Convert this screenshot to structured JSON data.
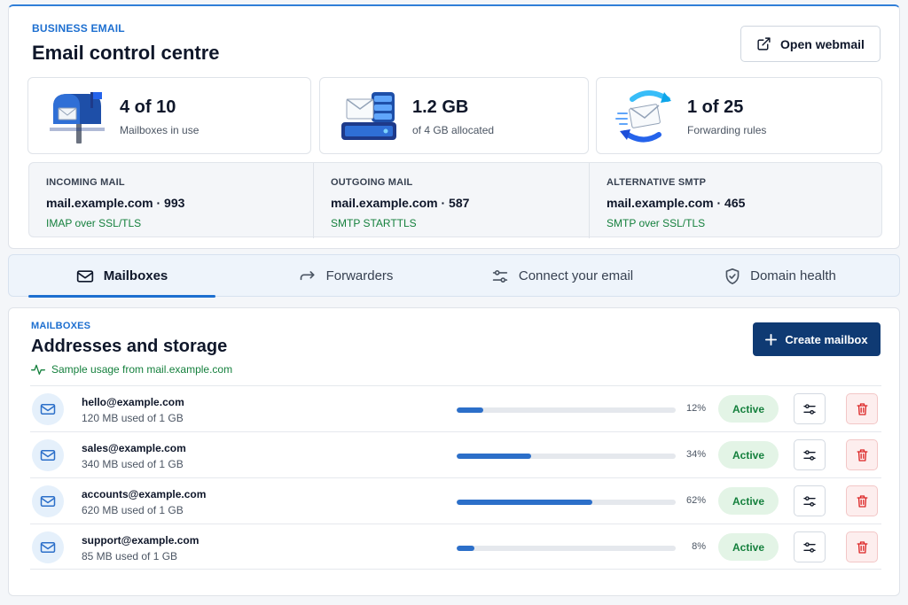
{
  "header": {
    "eyebrow": "BUSINESS EMAIL",
    "title": "Email control centre",
    "open_webmail_label": "Open webmail"
  },
  "stats": [
    {
      "value": "4 of 10",
      "label": "Mailboxes in use",
      "icon": "mailbox-icon"
    },
    {
      "value": "1.2 GB",
      "label": "of 4 GB allocated",
      "icon": "mail-server-icon"
    },
    {
      "value": "1 of 25",
      "label": "Forwarding rules",
      "icon": "forwarding-icon"
    }
  ],
  "servers": [
    {
      "label": "INCOMING MAIL",
      "host": "mail.example.com · 993",
      "security": "IMAP over SSL/TLS"
    },
    {
      "label": "OUTGOING MAIL",
      "host": "mail.example.com · 587",
      "security": "SMTP STARTTLS"
    },
    {
      "label": "ALTERNATIVE SMTP",
      "host": "mail.example.com · 465",
      "security": "SMTP over SSL/TLS"
    }
  ],
  "tabs": [
    {
      "label": "Mailboxes",
      "icon": "envelope-icon",
      "active": true
    },
    {
      "label": "Forwarders",
      "icon": "arrow-right-icon",
      "active": false
    },
    {
      "label": "Connect your email",
      "icon": "sliders-icon",
      "active": false
    },
    {
      "label": "Domain health",
      "icon": "shield-check-icon",
      "active": false
    }
  ],
  "mailboxes": {
    "eyebrow": "MAILBOXES",
    "title": "Addresses and storage",
    "subtitle": "Sample usage from mail.example.com",
    "create_label": "Create mailbox",
    "rows": [
      {
        "address": "hello@example.com",
        "usage": "120 MB used of 1 GB",
        "percent_label": "12%",
        "percent": 12,
        "status": "Active"
      },
      {
        "address": "sales@example.com",
        "usage": "340 MB used of 1 GB",
        "percent_label": "34%",
        "percent": 34,
        "status": "Active"
      },
      {
        "address": "accounts@example.com",
        "usage": "620 MB used of 1 GB",
        "percent_label": "62%",
        "percent": 62,
        "status": "Active"
      },
      {
        "address": "support@example.com",
        "usage": "85 MB used of 1 GB",
        "percent_label": "8%",
        "percent": 8,
        "status": "Active"
      }
    ]
  },
  "colors": {
    "accent": "#1d6fd0",
    "primary_button": "#0f3a73",
    "success": "#15803d",
    "danger": "#dc2626"
  }
}
